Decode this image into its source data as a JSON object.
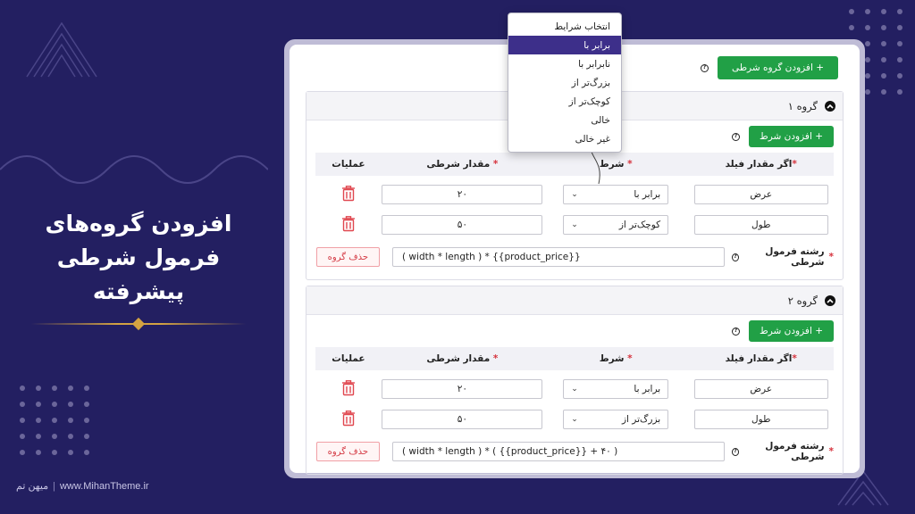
{
  "hero": {
    "title": "افزودن گروه‌های\nفرمول شرطی\nپیشرفته"
  },
  "footer": {
    "website": "www.MihanTheme.ir",
    "brand": "میهن تم"
  },
  "toolbar": {
    "add_group_label": "+ افزودن گروه شرطی"
  },
  "dropdown": {
    "items": [
      "انتخاب شرایط",
      "برابر با",
      "نابرابر با",
      "بزرگ‌تر از",
      "کوچک‌تر از",
      "خالی",
      "غیر خالی"
    ],
    "selected": "برابر با"
  },
  "columns": {
    "field": "اگر مقدار فیلد",
    "condition": "شرط",
    "value": "مقدار شرطی",
    "operations": "عملیات",
    "required_mark": "*"
  },
  "groups": [
    {
      "title": "گروه ۱",
      "add_condition_label": "+ افزودن شرط",
      "rows": [
        {
          "field": "عرض",
          "condition": "برابر با",
          "value": "۲۰"
        },
        {
          "field": "طول",
          "condition": "کوچک‌تر از",
          "value": "۵۰"
        }
      ],
      "formula_label": "رشته فرمول شرطی",
      "formula": "( width * length ) * {{product_price}}",
      "delete_label": "حذف گروه"
    },
    {
      "title": "گروه ۲",
      "add_condition_label": "+ افزودن شرط",
      "rows": [
        {
          "field": "عرض",
          "condition": "برابر با",
          "value": "۲۰"
        },
        {
          "field": "طول",
          "condition": "بزرگ‌تر از",
          "value": "۵۰"
        }
      ],
      "formula_label": "رشته فرمول شرطی",
      "formula": "( width * length ) * ( {{product_price}} + ۴۰ )",
      "delete_label": "حذف گروه"
    }
  ],
  "colors": {
    "background": "#231f61",
    "accent_green": "#21a046",
    "selected_purple": "#3d2f8a",
    "danger_red": "#d43a44",
    "gold": "#d4a342"
  },
  "icons": {
    "help": "help-circle-icon",
    "toggle": "chevron-up-icon",
    "delete": "trash-icon",
    "select": "chevron-down-icon"
  }
}
